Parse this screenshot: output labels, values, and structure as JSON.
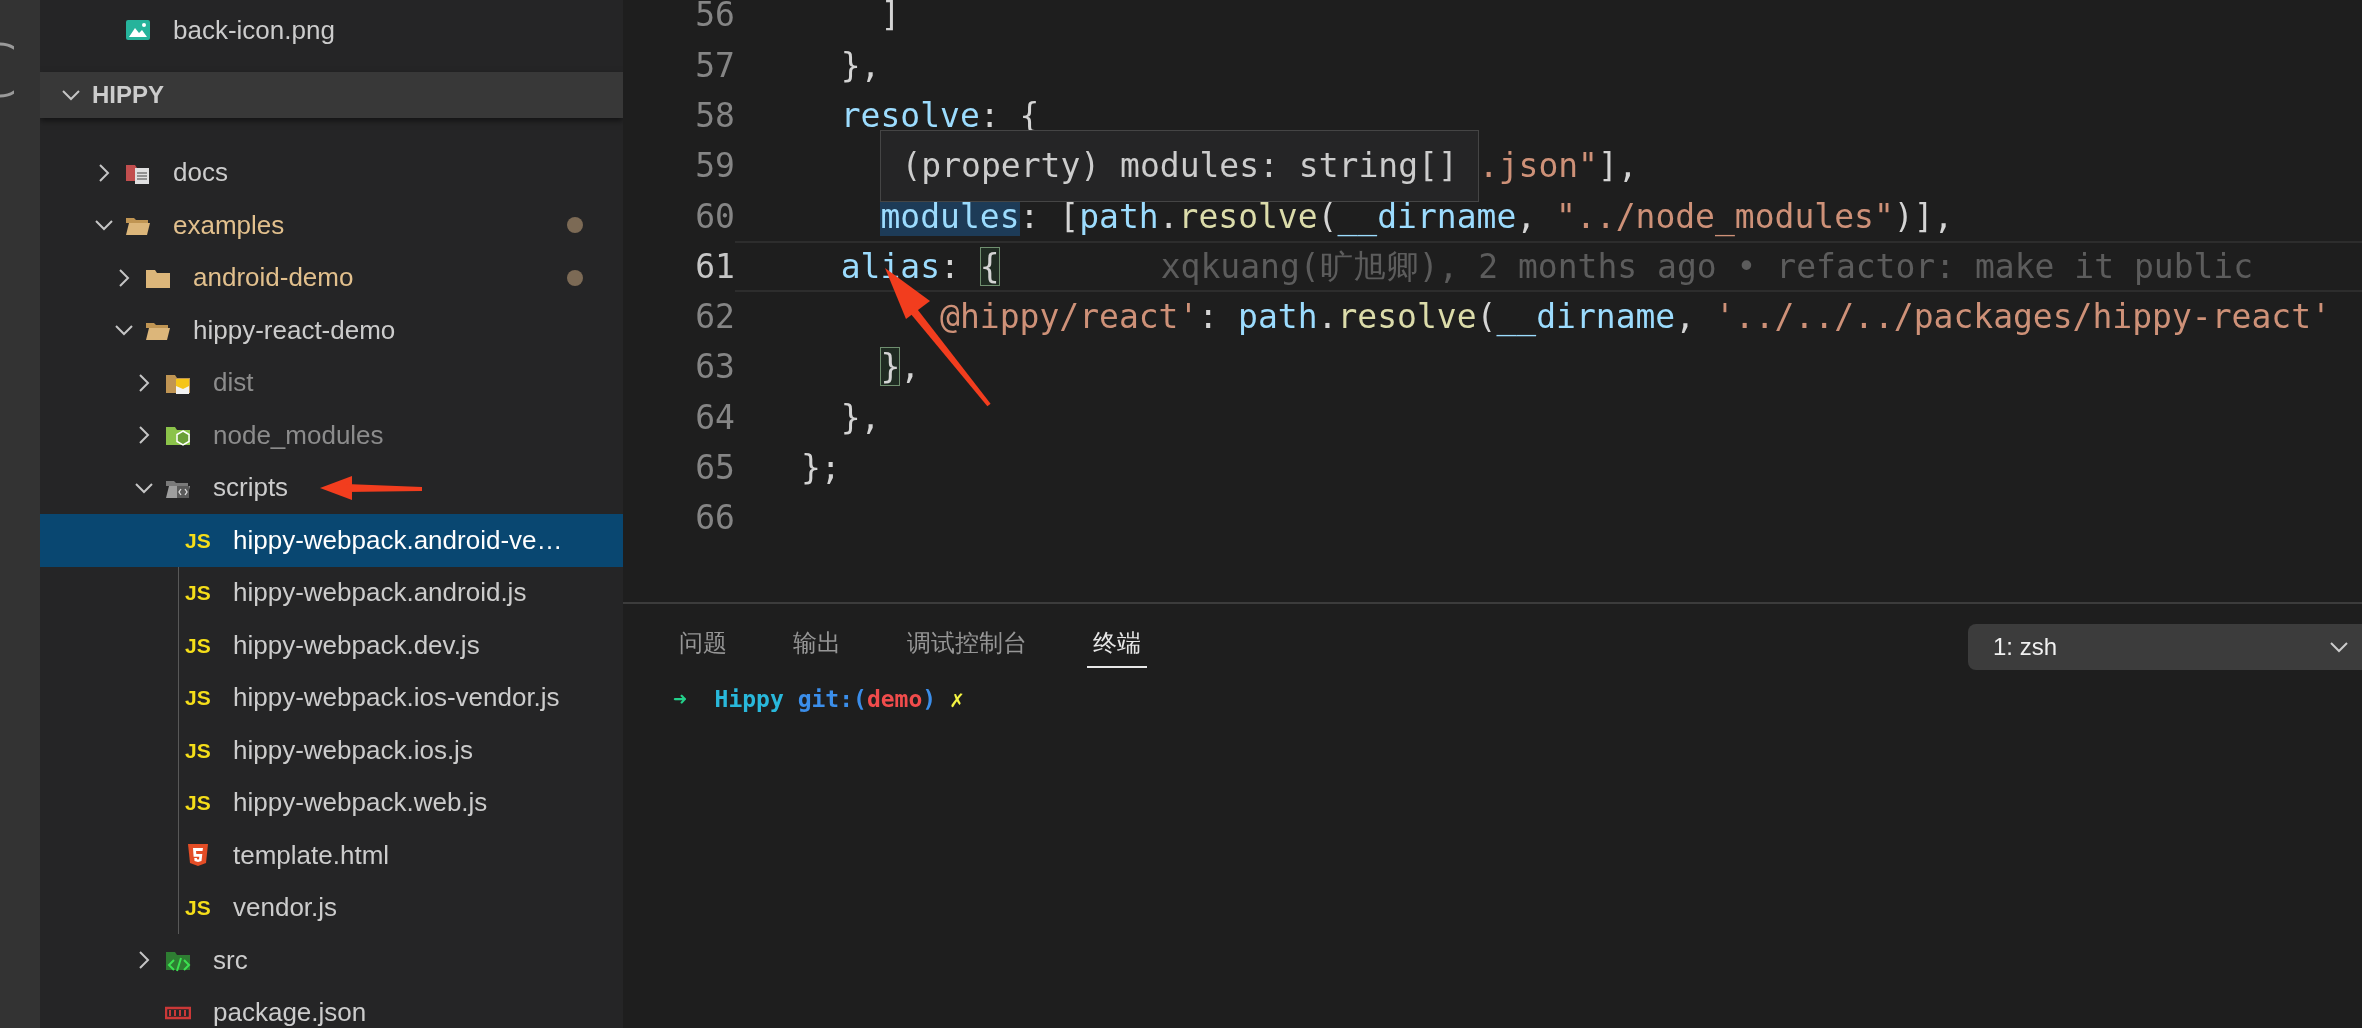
{
  "sidebar": {
    "top_items": [
      {
        "label": "back-icon.png",
        "kind": "image",
        "selected": false
      }
    ],
    "section": {
      "title": "HIPPY",
      "expanded": true
    },
    "tree": [
      {
        "label": "docs",
        "kind": "docs-folder",
        "expanded": false,
        "selected": false,
        "modified": false,
        "ignored": false
      },
      {
        "label": "examples",
        "kind": "folder",
        "expanded": true,
        "selected": false,
        "modified": true,
        "ignored": false,
        "children": [
          {
            "label": "android-demo",
            "kind": "folder",
            "expanded": false,
            "selected": false,
            "modified": true,
            "ignored": false
          },
          {
            "label": "hippy-react-demo",
            "kind": "folder",
            "expanded": true,
            "selected": false,
            "modified": false,
            "ignored": false,
            "children": [
              {
                "label": "dist",
                "kind": "dist-folder",
                "expanded": false,
                "selected": false,
                "modified": false,
                "ignored": true
              },
              {
                "label": "node_modules",
                "kind": "node-folder",
                "expanded": false,
                "selected": false,
                "modified": false,
                "ignored": true
              },
              {
                "label": "scripts",
                "kind": "scripts-folder",
                "expanded": true,
                "selected": false,
                "modified": false,
                "ignored": false,
                "children": [
                  {
                    "label": "hippy-webpack.android-ve…",
                    "kind": "js",
                    "badge": "JS",
                    "selected": true,
                    "modified": false,
                    "ignored": false
                  },
                  {
                    "label": "hippy-webpack.android.js",
                    "kind": "js",
                    "badge": "JS",
                    "selected": false,
                    "modified": false,
                    "ignored": false
                  },
                  {
                    "label": "hippy-webpack.dev.js",
                    "kind": "js",
                    "badge": "JS",
                    "selected": false,
                    "modified": false,
                    "ignored": false
                  },
                  {
                    "label": "hippy-webpack.ios-vendor.js",
                    "kind": "js",
                    "badge": "JS",
                    "selected": false,
                    "modified": false,
                    "ignored": false
                  },
                  {
                    "label": "hippy-webpack.ios.js",
                    "kind": "js",
                    "badge": "JS",
                    "selected": false,
                    "modified": false,
                    "ignored": false
                  },
                  {
                    "label": "hippy-webpack.web.js",
                    "kind": "js",
                    "badge": "JS",
                    "selected": false,
                    "modified": false,
                    "ignored": false
                  },
                  {
                    "label": "template.html",
                    "kind": "html",
                    "selected": false,
                    "modified": false,
                    "ignored": false
                  },
                  {
                    "label": "vendor.js",
                    "kind": "js",
                    "badge": "JS",
                    "selected": false,
                    "modified": false,
                    "ignored": false
                  }
                ]
              },
              {
                "label": "src",
                "kind": "src-folder",
                "expanded": false,
                "selected": false,
                "modified": false,
                "ignored": false
              },
              {
                "label": "package.json",
                "kind": "npm",
                "selected": false,
                "modified": false,
                "ignored": false
              }
            ]
          }
        ]
      }
    ]
  },
  "editor": {
    "lines": [
      {
        "number": "56",
        "current": false,
        "tokens": [
          {
            "kind": "punc",
            "text": "    ]"
          }
        ]
      },
      {
        "number": "57",
        "current": false,
        "tokens": [
          {
            "kind": "punc",
            "text": "  },"
          }
        ]
      },
      {
        "number": "58",
        "current": false,
        "tokens": [
          {
            "kind": "prop",
            "text": "  resolve"
          },
          {
            "kind": "punc",
            "text": ": {"
          }
        ]
      },
      {
        "number": "59",
        "current": false,
        "tokens": [
          {
            "kind": "tooltip",
            "text": "    (property) modules: string[]"
          },
          {
            "kind": "str",
            "text": ".json\""
          },
          {
            "kind": "punc",
            "text": "],"
          }
        ]
      },
      {
        "number": "60",
        "current": false,
        "tokens": [
          {
            "kind": "word",
            "text": "    modules"
          },
          {
            "kind": "punc",
            "text": ": ["
          },
          {
            "kind": "prop",
            "text": "path"
          },
          {
            "kind": "punc",
            "text": "."
          },
          {
            "kind": "func",
            "text": "resolve"
          },
          {
            "kind": "punc",
            "text": "("
          },
          {
            "kind": "prop",
            "text": "__dirname"
          },
          {
            "kind": "punc",
            "text": ", "
          },
          {
            "kind": "str",
            "text": "\"../node_modules\""
          },
          {
            "kind": "punc",
            "text": ")],"
          }
        ]
      },
      {
        "number": "61",
        "current": true,
        "tokens": [
          {
            "kind": "prop",
            "text": "  alias"
          },
          {
            "kind": "punc",
            "text": ": "
          },
          {
            "kind": "match",
            "text": "{"
          },
          {
            "kind": "blame",
            "text": "xqkuang(旷旭卿), 2 months ago • refactor: make it public"
          }
        ]
      },
      {
        "number": "62",
        "current": false,
        "tokens": [
          {
            "kind": "str",
            "text": "       @hippy/react'"
          },
          {
            "kind": "punc",
            "text": ": "
          },
          {
            "kind": "prop",
            "text": "path"
          },
          {
            "kind": "punc",
            "text": "."
          },
          {
            "kind": "func",
            "text": "resolve"
          },
          {
            "kind": "punc",
            "text": "("
          },
          {
            "kind": "prop",
            "text": "__dirname"
          },
          {
            "kind": "punc",
            "text": ", "
          },
          {
            "kind": "str",
            "text": "'../../../packages/hippy-react'"
          }
        ]
      },
      {
        "number": "63",
        "current": false,
        "tokens": [
          {
            "kind": "match",
            "text": "    }"
          },
          {
            "kind": "punc",
            "text": ","
          }
        ]
      },
      {
        "number": "64",
        "current": false,
        "tokens": [
          {
            "kind": "punc",
            "text": "  },"
          }
        ]
      },
      {
        "number": "65",
        "current": false,
        "tokens": [
          {
            "kind": "punc",
            "text": "};"
          }
        ]
      },
      {
        "number": "66",
        "current": false
      }
    ]
  },
  "panel": {
    "tabs": [
      {
        "label": "问题",
        "selected": false
      },
      {
        "label": "输出",
        "selected": false
      },
      {
        "label": "调试控制台",
        "selected": false
      },
      {
        "label": "终端",
        "selected": true
      }
    ],
    "terminal_select": {
      "value": "1: zsh"
    },
    "terminal_lines": [
      [
        {
          "kind": "arrow",
          "text": "➜"
        },
        {
          "kind": "dir",
          "text": "  Hippy"
        },
        {
          "kind": "git",
          "text": " git:("
        },
        {
          "kind": "branch",
          "text": "demo"
        },
        {
          "kind": "git",
          "text": ")"
        },
        {
          "kind": "dirty",
          "text": " ✗"
        }
      ]
    ]
  }
}
